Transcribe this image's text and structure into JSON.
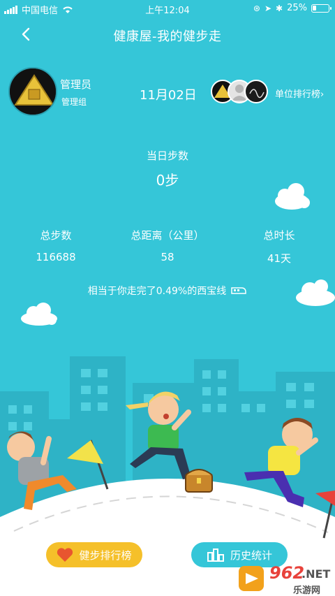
{
  "status_bar": {
    "carrier": "中国电信",
    "time": "上午12:04",
    "battery": "25%",
    "battery_level": 0.25
  },
  "nav": {
    "title": "健康屋-我的健步走",
    "back_icon": "chevron-left-icon"
  },
  "user": {
    "name": "管理员",
    "group": "管理组"
  },
  "date": "11月02日",
  "unit_rank": {
    "label": "单位排行榜",
    "arrow": "›"
  },
  "today": {
    "label": "当日步数",
    "value": "0步"
  },
  "stats": [
    {
      "label": "总步数",
      "value": "116688"
    },
    {
      "label": "总距离（公里）",
      "value": "58"
    },
    {
      "label": "总时长",
      "value": "41天"
    }
  ],
  "equivalent": "相当于你走完了0.49%的西宝线",
  "buttons": {
    "rank": "健步排行榜",
    "history": "历史统计"
  },
  "watermark": {
    "number": "962",
    "domain": ".NET",
    "chinese": "乐游网"
  },
  "colors": {
    "background": "#35c6d8",
    "rank_button": "#f5c02a",
    "heart": "#e8562f"
  }
}
